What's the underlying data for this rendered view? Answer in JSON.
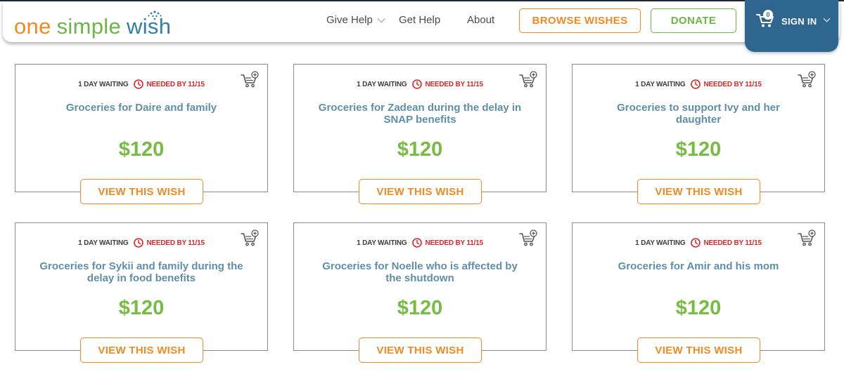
{
  "header": {
    "logo": {
      "one": "one",
      "simple": "simple",
      "wish": "wish"
    },
    "nav": [
      {
        "label": "Give Help"
      },
      {
        "label": "Get Help"
      },
      {
        "label": "About"
      }
    ],
    "browse_label": "BROWSE WISHES",
    "donate_label": "DONATE",
    "cart_count": "0",
    "signin_label": "SIGN IN",
    "colors": {
      "orange": "#f08a24",
      "green": "#6cb546",
      "blue": "#2f7fa6",
      "signin_bg": "#2f6690"
    }
  },
  "wishes": [
    {
      "waiting": "1 DAY WAITING",
      "needed": "NEEDED BY 11/15",
      "title": "Groceries for Daire and family",
      "amount": "$120",
      "cta": "VIEW THIS WISH"
    },
    {
      "waiting": "1 DAY WAITING",
      "needed": "NEEDED BY 11/15",
      "title": "Groceries for Zadean during the delay in SNAP benefits",
      "amount": "$120",
      "cta": "VIEW THIS WISH"
    },
    {
      "waiting": "1 DAY WAITING",
      "needed": "NEEDED BY 11/15",
      "title": "Groceries to support Ivy and her daughter",
      "amount": "$120",
      "cta": "VIEW THIS WISH"
    },
    {
      "waiting": "1 DAY WAITING",
      "needed": "NEEDED BY 11/15",
      "title": "Groceries for Sykii and family during the delay in food benefits",
      "amount": "$120",
      "cta": "VIEW THIS WISH"
    },
    {
      "waiting": "1 DAY WAITING",
      "needed": "NEEDED BY 11/15",
      "title": "Groceries for Noelle who is affected by the shutdown",
      "amount": "$120",
      "cta": "VIEW THIS WISH"
    },
    {
      "waiting": "1 DAY WAITING",
      "needed": "NEEDED BY 11/15",
      "title": "Groceries for Amir and his mom",
      "amount": "$120",
      "cta": "VIEW THIS WISH"
    }
  ]
}
